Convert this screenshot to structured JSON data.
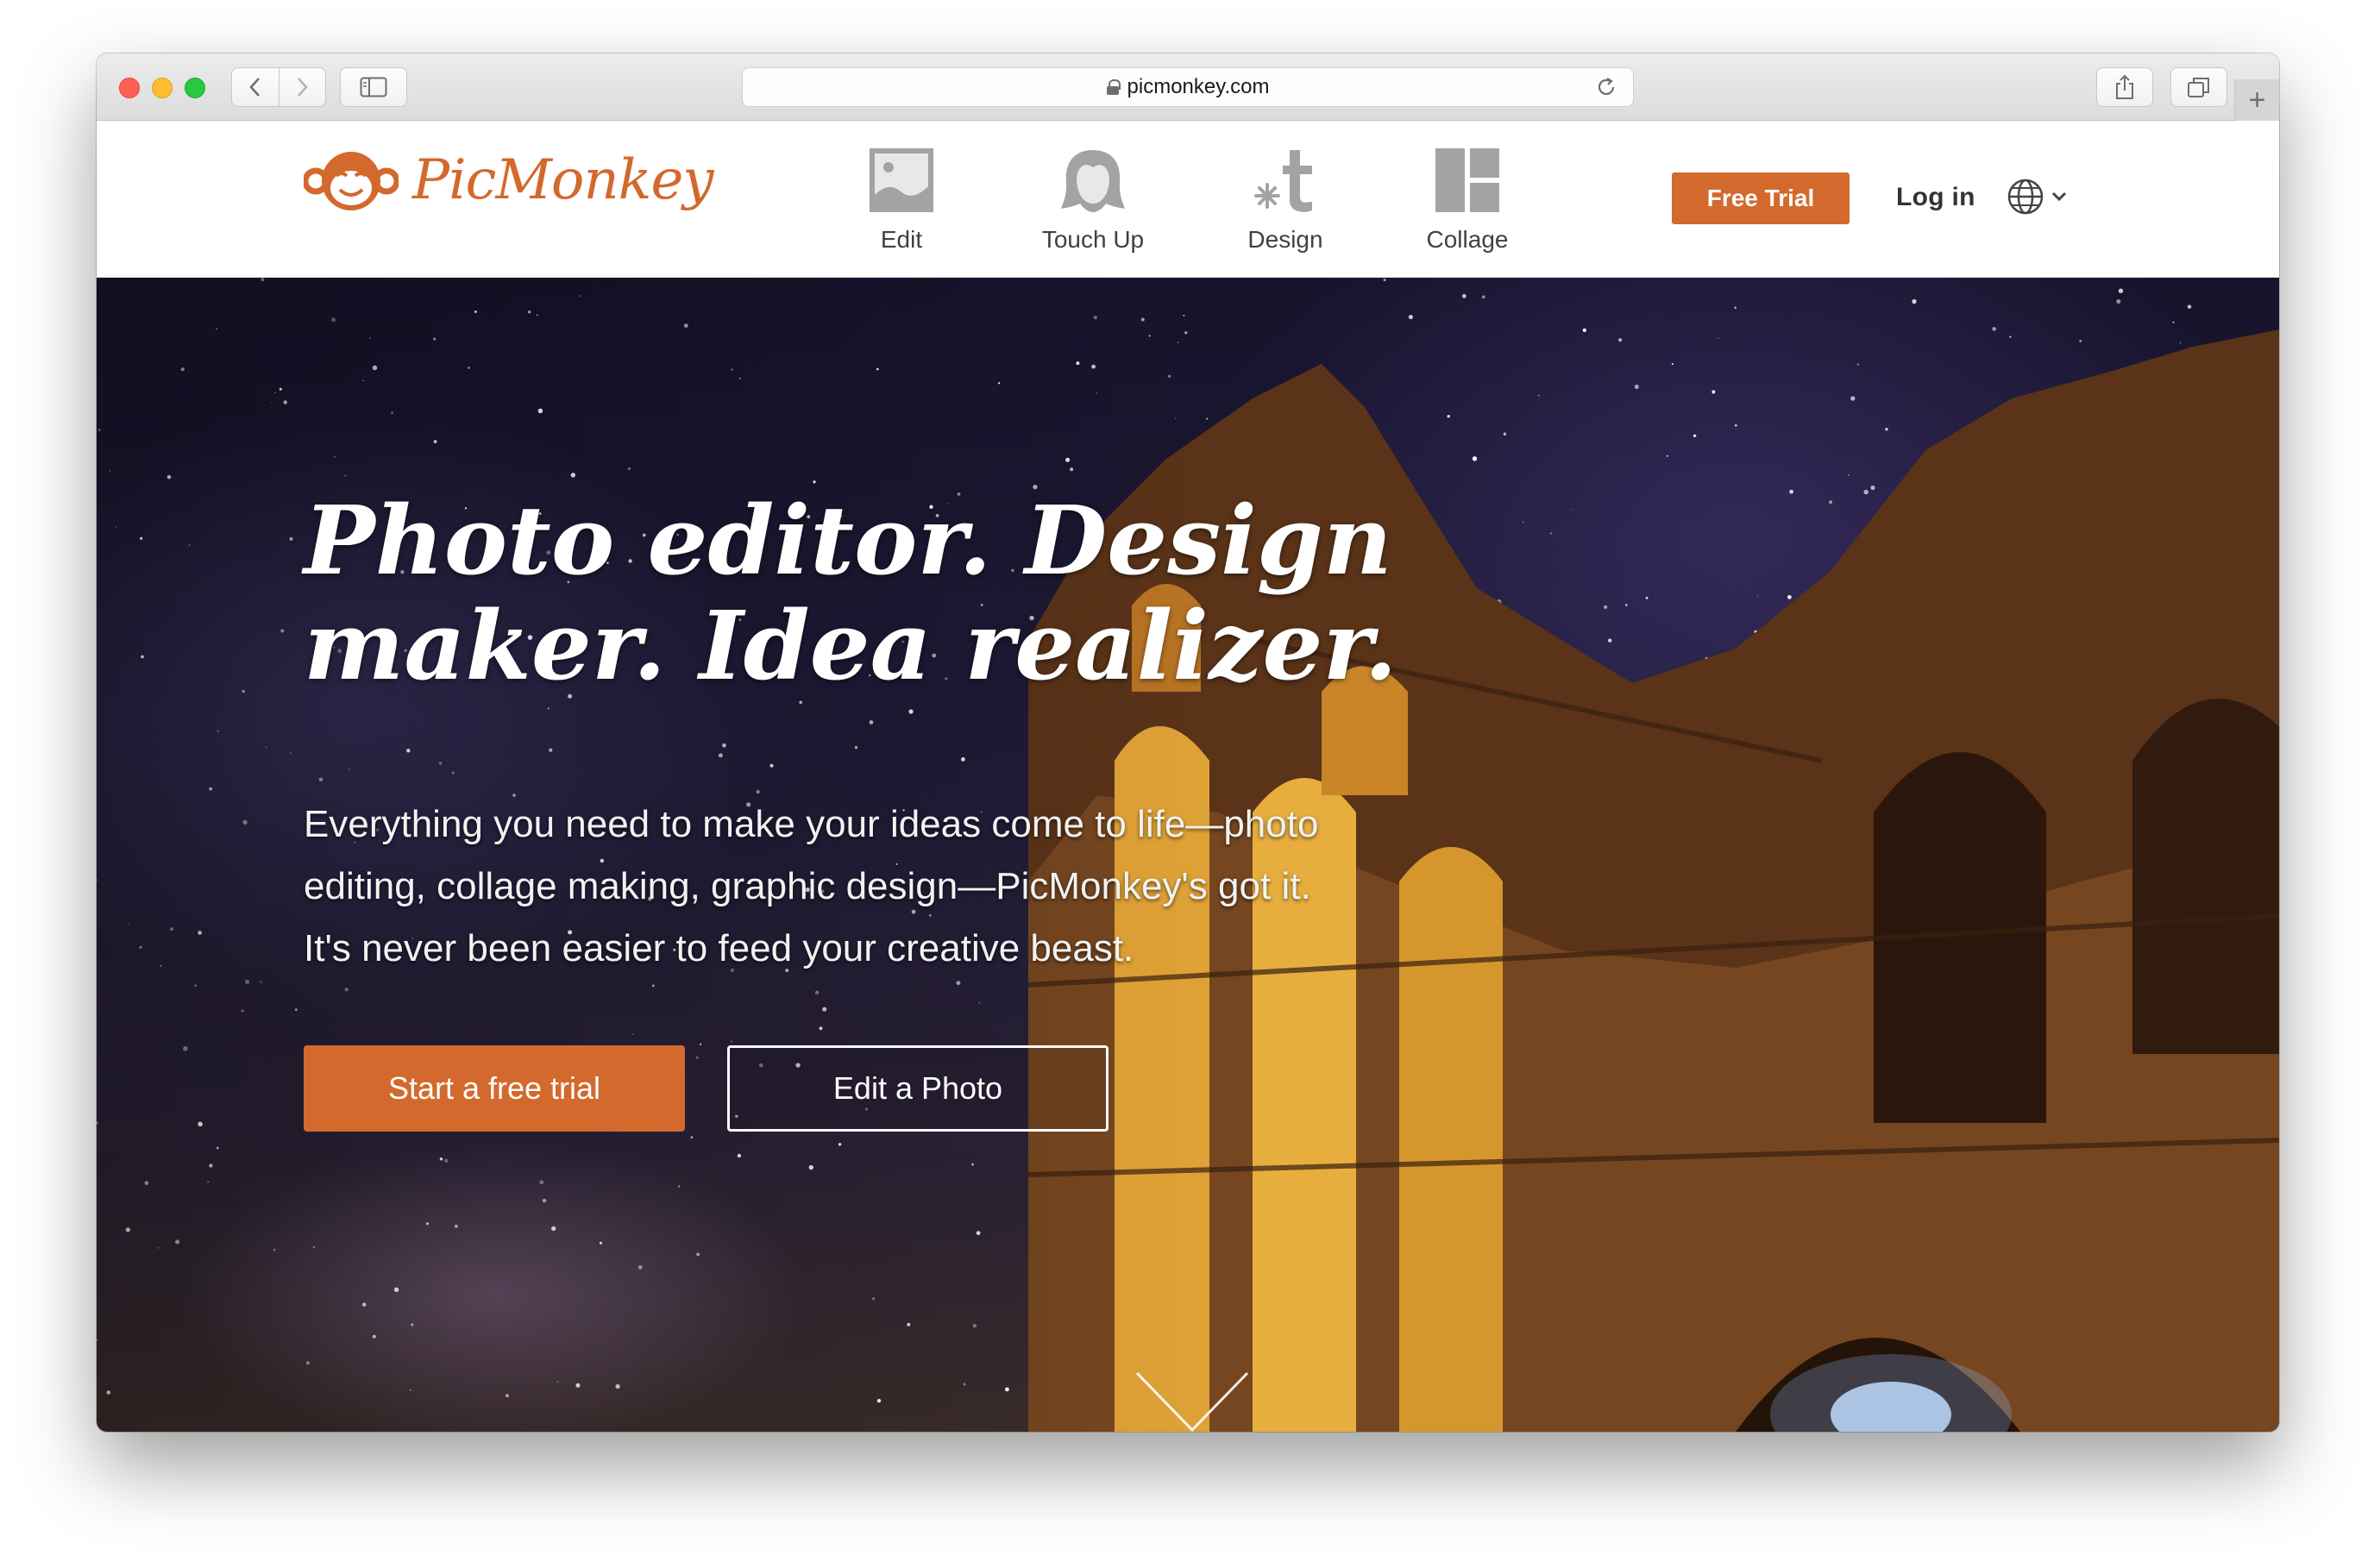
{
  "browser": {
    "url": "picmonkey.com"
  },
  "header": {
    "logo_text": "PicMonkey",
    "nav": [
      {
        "label": "Edit",
        "icon": "photo-icon"
      },
      {
        "label": "Touch Up",
        "icon": "face-icon"
      },
      {
        "label": "Design",
        "icon": "design-icon"
      },
      {
        "label": "Collage",
        "icon": "collage-icon"
      }
    ],
    "free_trial_label": "Free Trial",
    "login_label": "Log in"
  },
  "hero": {
    "headline_line1": "Photo editor. Design",
    "headline_line2": "maker. Idea realizer.",
    "sub_line1": "Everything you need to make your ideas come to life—photo",
    "sub_line2": "editing, collage making, graphic design—PicMonkey's got it.",
    "sub_line3": "It's never been easier to feed your creative beast.",
    "cta_primary": "Start a free trial",
    "cta_secondary": "Edit a Photo"
  },
  "colors": {
    "brand": "#d3692c",
    "nav_icon": "#8f8f8f"
  }
}
